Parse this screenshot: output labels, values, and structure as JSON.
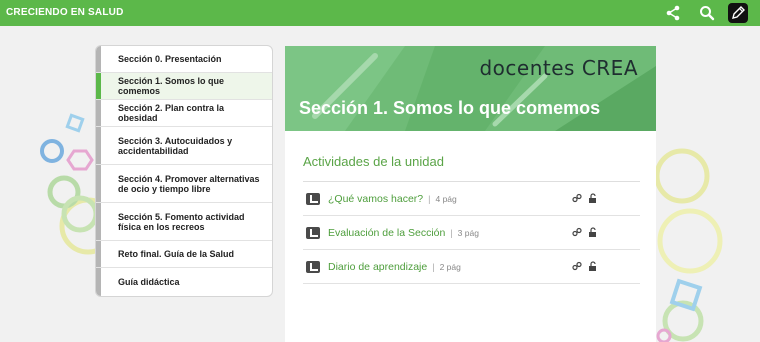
{
  "header": {
    "title": "CRECIENDO EN SALUD",
    "icons": [
      "share-icon",
      "search-icon",
      "pencil-icon"
    ]
  },
  "sidebar": {
    "items": [
      {
        "label": "Sección 0. Presentación"
      },
      {
        "label": "Sección 1. Somos lo que comemos",
        "active": true
      },
      {
        "label": "Sección 2. Plan contra la obesidad"
      },
      {
        "label": "Sección 3. Autocuidados y accidentabilidad"
      },
      {
        "label": "Sección 4. Promover alternativas de ocio y tiempo libre"
      },
      {
        "label": "Sección 5. Fomento actividad física en los recreos"
      },
      {
        "label": "Reto final. Guía de la Salud"
      },
      {
        "label": "Guía didáctica"
      }
    ]
  },
  "banner": {
    "brand": "docentes CREA",
    "heading": "Sección 1. Somos lo que comemos"
  },
  "activities": {
    "title": "Actividades de la unidad",
    "separator": "|",
    "items": [
      {
        "label": "¿Qué vamos hacer?",
        "pages": "4 pág"
      },
      {
        "label": "Evaluación de la Sección",
        "pages": "3 pág"
      },
      {
        "label": "Diario de aprendizaje",
        "pages": "2 pág"
      }
    ]
  },
  "colors": {
    "accent": "#5cb84a",
    "link": "#4e9e3c",
    "banner": "#6fbb77"
  }
}
